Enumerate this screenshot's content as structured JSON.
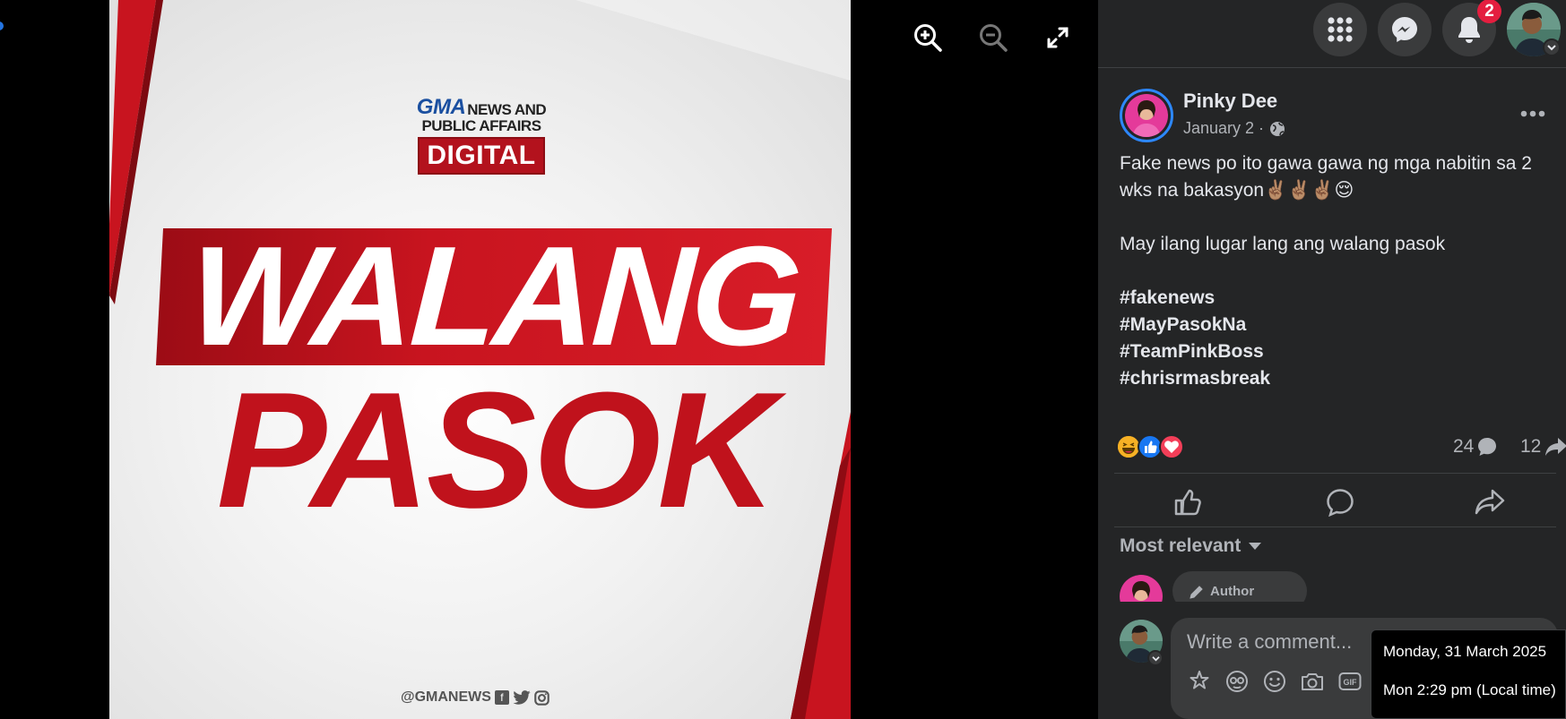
{
  "viewer": {
    "tools": [
      {
        "name": "zoom-in-icon"
      },
      {
        "name": "zoom-out-icon"
      },
      {
        "name": "fullscreen-icon"
      }
    ],
    "photo": {
      "logo_line1_brand": "GMA",
      "logo_line1_rest": "NEWS AND",
      "logo_line2": "PUBLIC AFFAIRS",
      "logo_badge": "DIGITAL",
      "headline_top": "WALANG",
      "headline_bottom": "PASOK",
      "social_handle": "@GMANEWS",
      "colors": {
        "red": "#c0121c",
        "blue": "#1a4fa0"
      }
    }
  },
  "nav": {
    "notification_count": "2",
    "icons": [
      "menu-grid-icon",
      "messenger-icon",
      "bell-icon",
      "profile-avatar"
    ]
  },
  "post": {
    "author": "Pinky Dee",
    "date": "January 2 ·",
    "privacy_icon": "globe-icon",
    "text_line1": "Fake news po ito gawa gawa ng mga nabitin sa 2 wks na bakasyon✌🏽✌🏽✌🏽😌",
    "text_line2": "May ilang lugar lang ang walang pasok",
    "hashtags": [
      "#fakenews",
      "#MayPasokNa",
      "#TeamPinkBoss",
      "#chrisrmasbreak"
    ],
    "reactions": [
      "haha",
      "like",
      "love"
    ],
    "comment_count": "24",
    "share_count": "12"
  },
  "actions": [
    "like-icon",
    "comment-icon",
    "share-icon"
  ],
  "comments": {
    "sort_label": "Most relevant",
    "author_badge": "Author",
    "composer_placeholder": "Write a comment...",
    "composer_tools": [
      "avatar-sticker-icon",
      "sticker-icon",
      "emoji-icon",
      "camera-icon",
      "gif-icon"
    ]
  },
  "tooltip": {
    "date_line": "Monday, 31 March 2025",
    "time_line": "Mon 2:29 pm (Local time)"
  }
}
